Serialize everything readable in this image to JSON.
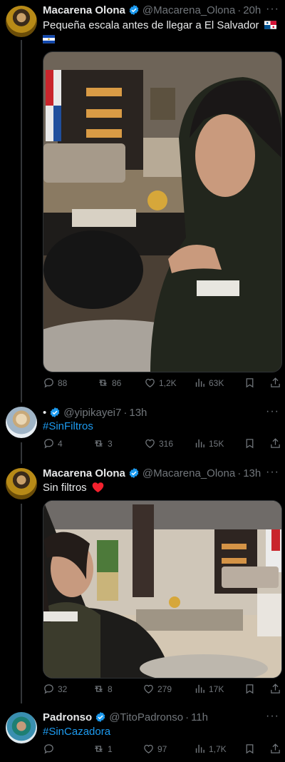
{
  "tweets": [
    {
      "name": "Macarena Olona",
      "handle": "@Macarena_Olona",
      "time": "20h",
      "text": "Pequeña escala antes de llegar a El Salvador",
      "reply_count": "88",
      "retweet_count": "86",
      "like_count": "1,2K",
      "view_count": "63K"
    },
    {
      "name": "",
      "handle": "@yipikayei7",
      "time": "13h",
      "text": "#SinFiltros",
      "reply_count": "4",
      "retweet_count": "3",
      "like_count": "316",
      "view_count": "15K"
    },
    {
      "name": "Macarena Olona",
      "handle": "@Macarena_Olona",
      "time": "13h",
      "text": "Sin filtros",
      "reply_count": "32",
      "retweet_count": "8",
      "like_count": "279",
      "view_count": "17K"
    },
    {
      "name": "Padronso",
      "handle": "@TitoPadronso",
      "time": "11h",
      "text": "#SinCazadora",
      "reply_count": "",
      "retweet_count": "1",
      "like_count": "97",
      "view_count": "1,7K"
    }
  ],
  "colors": {
    "background": "#000000",
    "text": "#e7e9ea",
    "muted": "#71767b",
    "link": "#1d9bf0",
    "verified": "#1d9bf0",
    "heart": "#f91880"
  }
}
